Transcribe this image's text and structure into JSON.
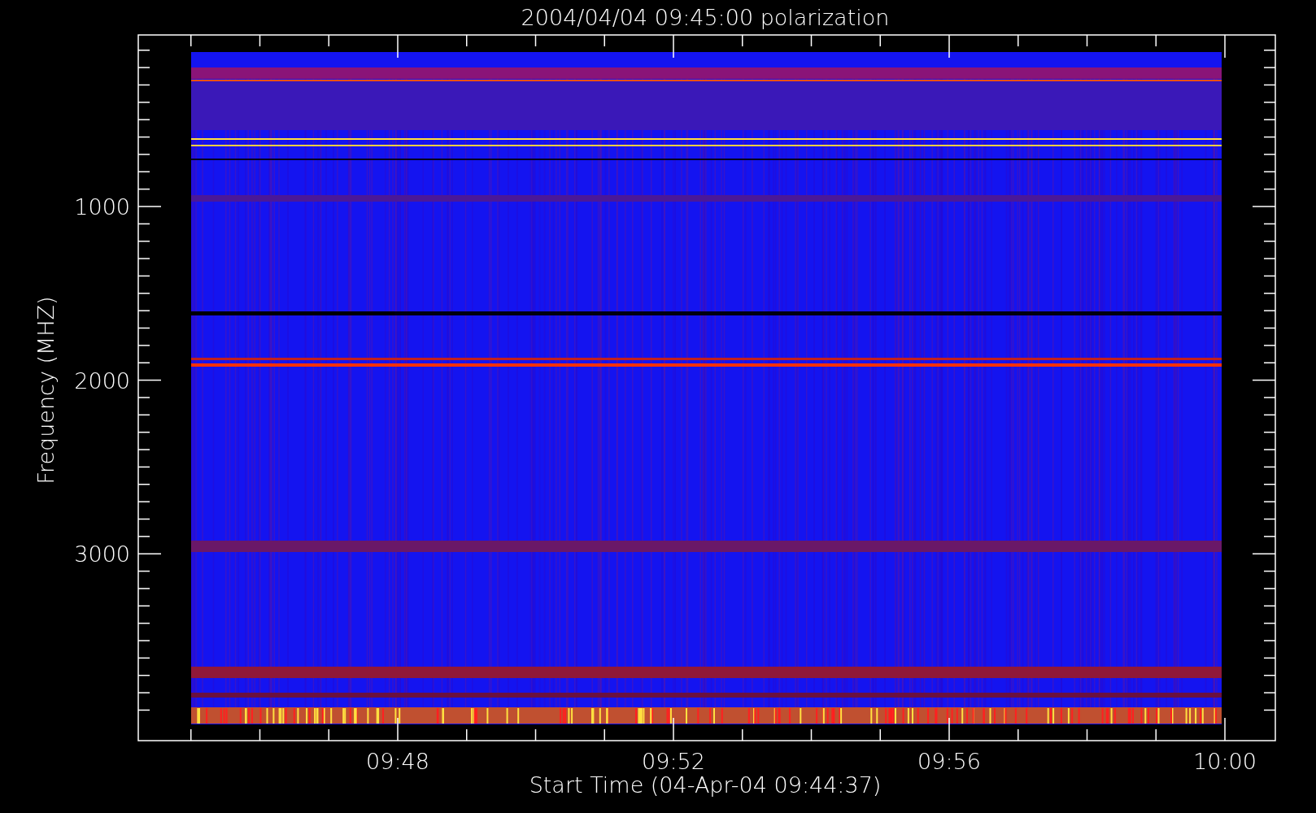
{
  "title": "2004/04/04 09:45:00 polarization",
  "y_axis": {
    "label": "Frequency (MHZ)",
    "tick_labels": [
      "1000",
      "2000",
      "3000"
    ]
  },
  "x_axis": {
    "label": "Start Time (04-Apr-04 09:44:37)",
    "tick_labels": [
      "09:48",
      "09:52",
      "09:56",
      "10:00"
    ]
  }
}
